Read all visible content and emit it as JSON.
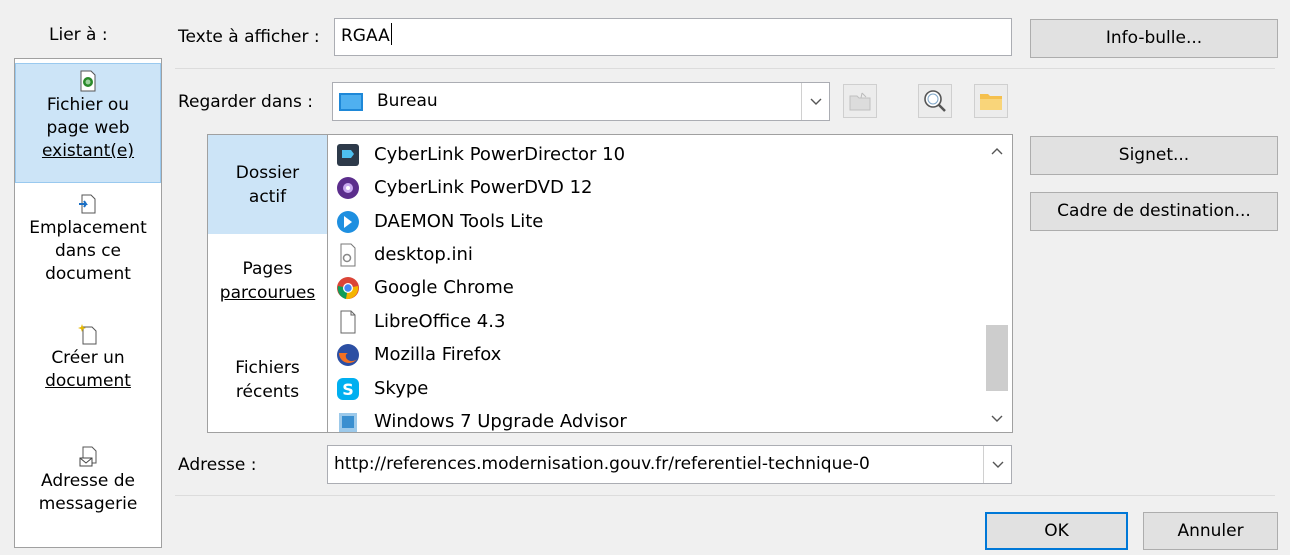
{
  "link_to": {
    "label": "Lier à :",
    "items": [
      {
        "lines": [
          "Fichier ou",
          "page web",
          "existant(e)"
        ],
        "icon": "web-page-file-icon"
      },
      {
        "lines": [
          "Emplacement",
          "dans ce",
          "document"
        ],
        "icon": "document-place-icon"
      },
      {
        "lines": [
          "Créer un",
          "document"
        ],
        "icon": "new-document-icon"
      },
      {
        "lines": [
          "Adresse de",
          "messagerie"
        ],
        "icon": "email-address-icon"
      }
    ]
  },
  "display_text": {
    "label": "Texte à afficher :",
    "value": "RGAA"
  },
  "buttons": {
    "infobulle": "Info-bulle...",
    "signet": "Signet...",
    "cadre": "Cadre de destination...",
    "ok": "OK",
    "annuler": "Annuler"
  },
  "look_in": {
    "label": "Regarder dans :",
    "value": "Bureau"
  },
  "browse_nav": [
    {
      "lines": [
        "Dossier",
        "actif"
      ]
    },
    {
      "lines": [
        "Pages",
        "parcourues"
      ]
    },
    {
      "lines": [
        "Fichiers",
        "récents"
      ]
    }
  ],
  "files": [
    {
      "name": "CyberLink PowerDirector 10",
      "icon": "powerdirector-icon"
    },
    {
      "name": "CyberLink PowerDVD 12",
      "icon": "powerdvd-icon"
    },
    {
      "name": "DAEMON Tools Lite",
      "icon": "daemon-tools-icon"
    },
    {
      "name": "desktop.ini",
      "icon": "ini-file-icon"
    },
    {
      "name": "Google Chrome",
      "icon": "chrome-icon"
    },
    {
      "name": "LibreOffice 4.3",
      "icon": "libreoffice-icon"
    },
    {
      "name": "Mozilla Firefox",
      "icon": "firefox-icon"
    },
    {
      "name": "Skype",
      "icon": "skype-icon"
    },
    {
      "name": "Windows 7 Upgrade Advisor",
      "icon": "windows-upgrade-icon"
    }
  ],
  "address": {
    "label": "Adresse :",
    "value": "http://references.modernisation.gouv.fr/referentiel-technique-0"
  },
  "colors": {
    "accent": "#0078d7",
    "selection": "#cce4f7"
  }
}
